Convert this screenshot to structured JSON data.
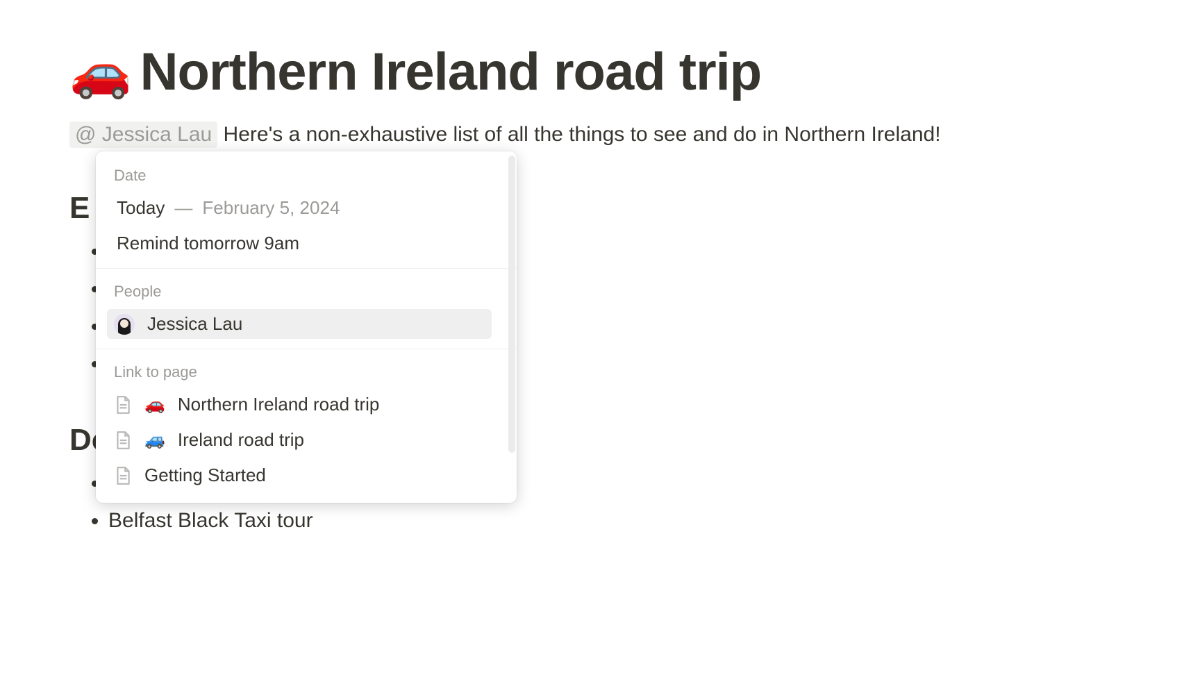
{
  "page": {
    "emoji": "🚗",
    "title": "Northern Ireland road trip"
  },
  "intro": {
    "mention_text": "@ Jessica Lau",
    "body": " Here's a non-exhaustive list of all the things to see and do in Northern Ireland!"
  },
  "sections": {
    "first_heading_initial": "E",
    "second_heading_partial": "Do",
    "visible_item": "Belfast Black Taxi tour"
  },
  "popup": {
    "date_label": "Date",
    "today_label": "Today",
    "today_date": "February 5, 2024",
    "remind_label": "Remind tomorrow 9am",
    "people_label": "People",
    "person_name": "Jessica Lau",
    "link_label": "Link to page",
    "links": [
      {
        "emoji": "🚗",
        "title": "Northern Ireland road trip"
      },
      {
        "emoji": "🚙",
        "title": "Ireland road trip"
      },
      {
        "emoji": "",
        "title": "Getting Started"
      }
    ]
  }
}
